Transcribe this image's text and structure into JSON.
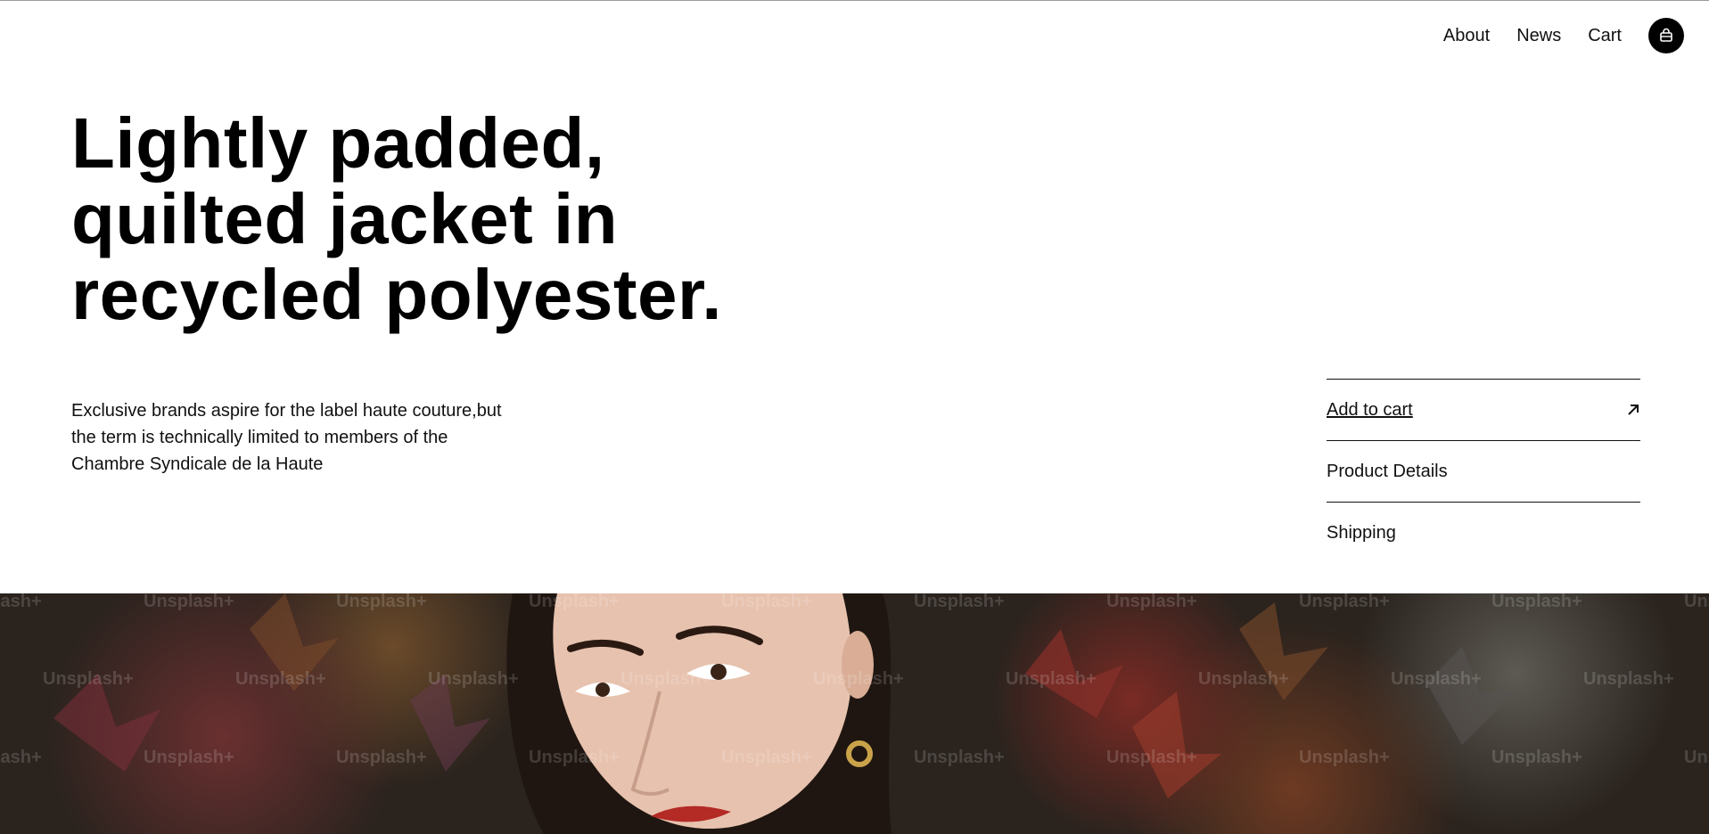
{
  "nav": {
    "links": [
      "About",
      "News",
      "Cart"
    ],
    "bag_icon": "shopping-bag-icon"
  },
  "hero": {
    "title": "Lightly padded, quilted jacket in recycled polyester.",
    "description": "Exclusive brands aspire for the label haute couture,but the term is technically limited to members of the Chambre Syndicale de la Haute"
  },
  "actions": {
    "add_to_cart": "Add to cart",
    "arrow_icon": "arrow-up-right-icon",
    "product_details": "Product Details",
    "shipping": "Shipping"
  },
  "image": {
    "watermark": "Unsplash+"
  },
  "colors": {
    "text": "#111111",
    "background": "#ffffff",
    "bag_button": "#000000"
  }
}
